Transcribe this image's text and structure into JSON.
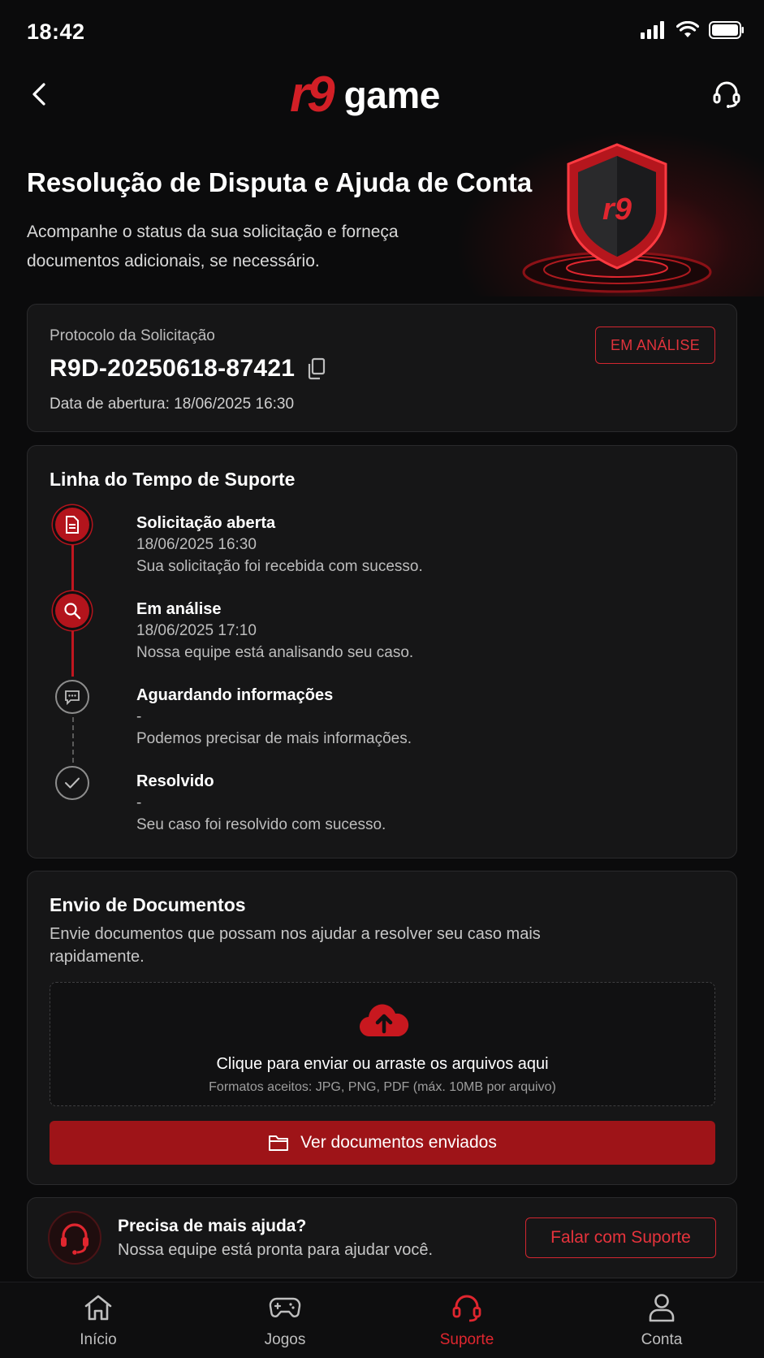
{
  "status_bar": {
    "time": "18:42"
  },
  "header": {
    "logo_mark": "r9",
    "logo_text": "game",
    "back_icon": "chevron-left-icon",
    "support_icon": "headset-icon"
  },
  "hero": {
    "title": "Resolução de Disputa e Ajuda de Conta",
    "subtitle": "Acompanhe o status da sua solicitação e forneça documentos adicionais, se necessário.",
    "shield_mark": "r9"
  },
  "protocol": {
    "label": "Protocolo da Solicitação",
    "number": "R9D-20250618-87421",
    "opened": "Data de abertura: 18/06/2025 16:30",
    "status": "EM ANÁLISE"
  },
  "timeline": {
    "title": "Linha do Tempo de Suporte",
    "steps": [
      {
        "title": "Solicitação aberta",
        "date": "18/06/2025 16:30",
        "desc": "Sua solicitação foi recebida com sucesso.",
        "icon": "document-icon",
        "state": "done"
      },
      {
        "title": "Em análise",
        "date": "18/06/2025 17:10",
        "desc": "Nossa equipe está analisando seu caso.",
        "icon": "search-icon",
        "state": "done"
      },
      {
        "title": "Aguardando informações",
        "date": "-",
        "desc": "Podemos precisar de mais informações.",
        "icon": "chat-icon",
        "state": "pending"
      },
      {
        "title": "Resolvido",
        "date": "-",
        "desc": "Seu caso foi resolvido com sucesso.",
        "icon": "check-icon",
        "state": "pending"
      }
    ]
  },
  "documents": {
    "title": "Envio de Documentos",
    "desc": "Envie documentos que possam nos ajudar a resolver seu caso mais rapidamente.",
    "dropzone_title": "Clique para enviar ou arraste os arquivos aqui",
    "dropzone_formats": "Formatos aceitos: JPG, PNG, PDF (máx. 10MB por arquivo)",
    "view_button": "Ver documentos enviados"
  },
  "help": {
    "title": "Precisa de mais ajuda?",
    "subtitle": "Nossa equipe está pronta para ajudar você.",
    "button": "Falar com Suporte"
  },
  "nav": {
    "items": [
      {
        "label": "Início",
        "icon": "home-icon"
      },
      {
        "label": "Jogos",
        "icon": "gamepad-icon"
      },
      {
        "label": "Suporte",
        "icon": "headset-icon",
        "active": true
      },
      {
        "label": "Conta",
        "icon": "user-icon"
      }
    ]
  },
  "colors": {
    "accent": "#d21f26",
    "background": "#0b0b0c",
    "card": "#161617"
  }
}
